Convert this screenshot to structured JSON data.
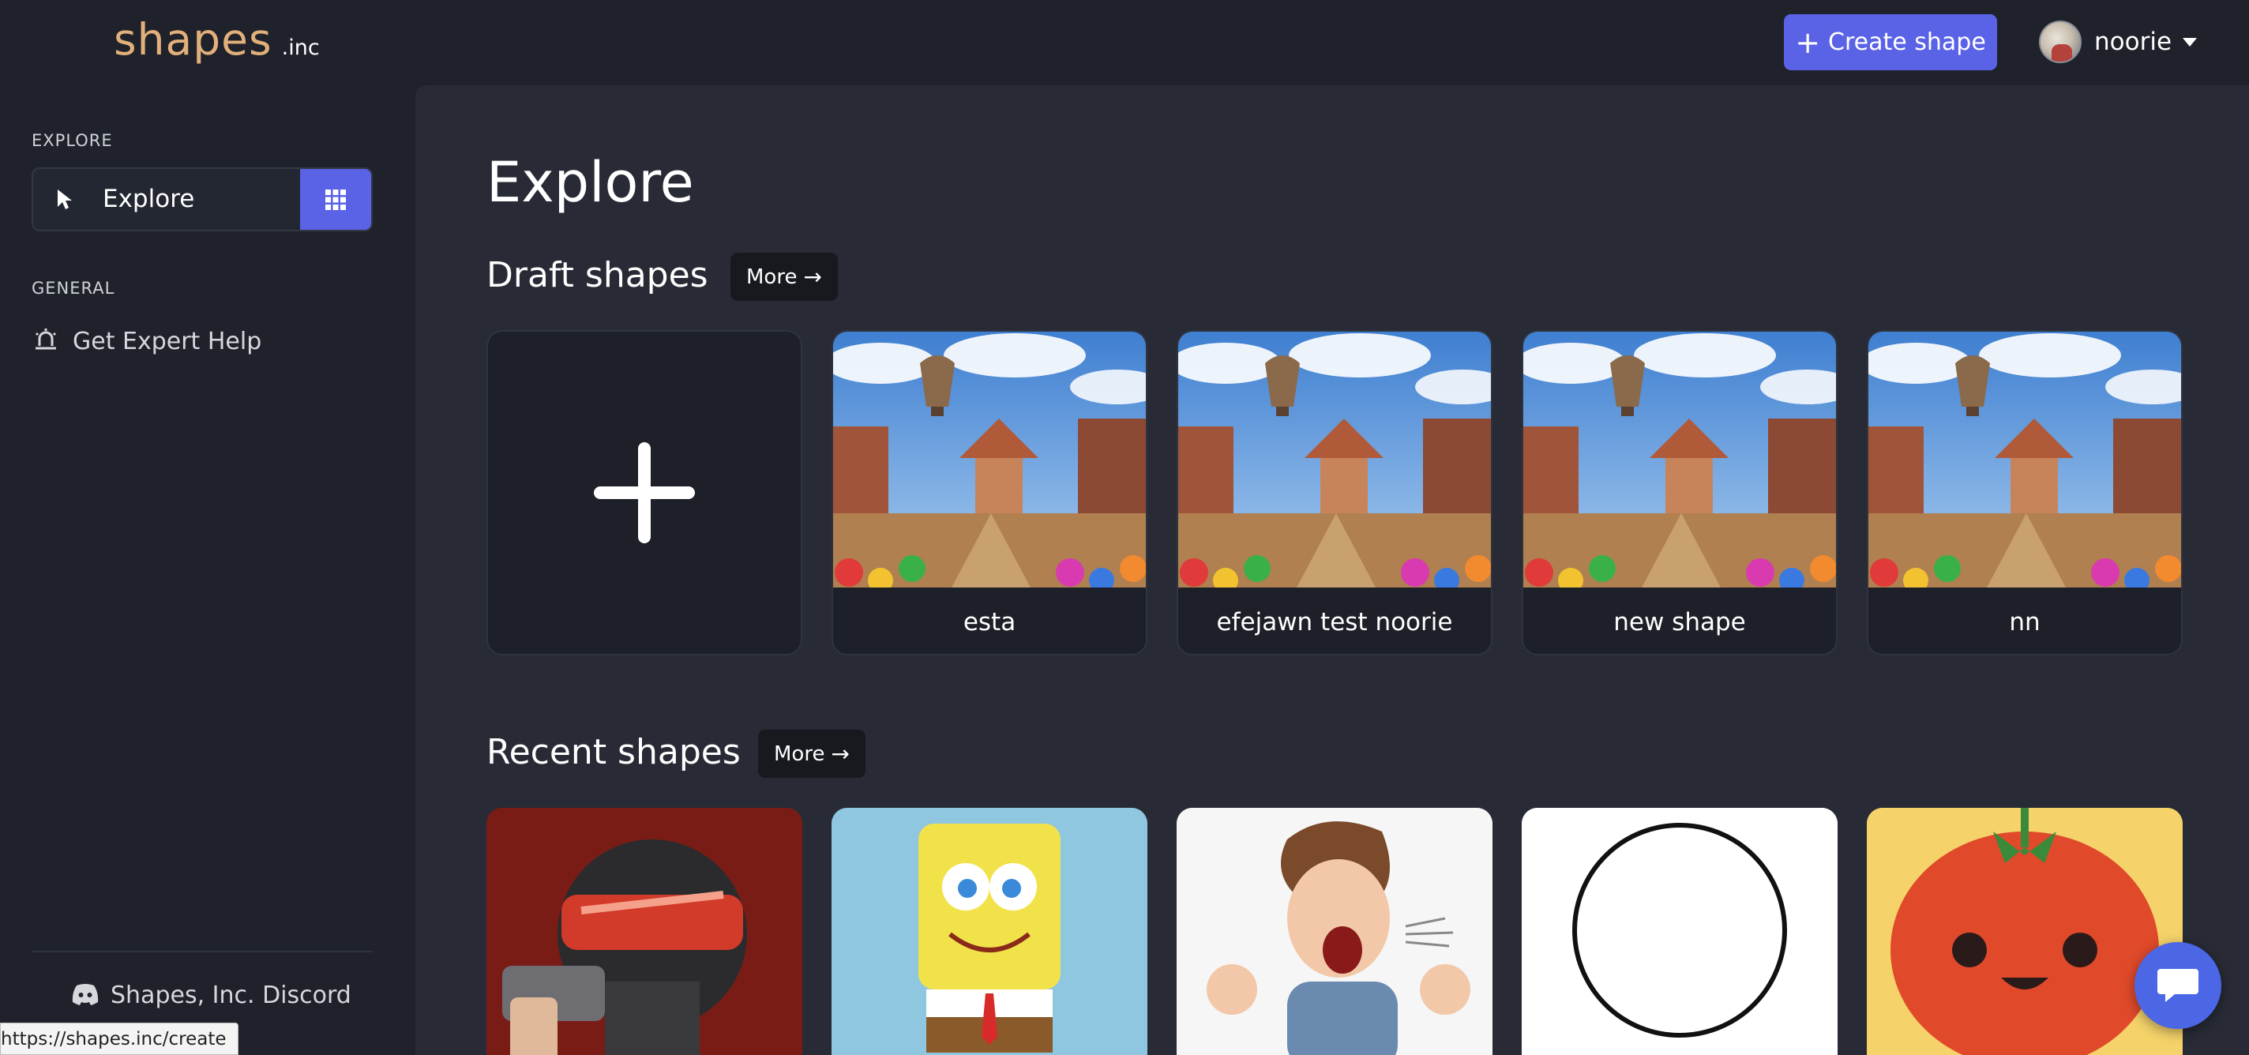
{
  "brand": {
    "name": "shapes",
    "suffix": ".inc",
    "color": "#e2b07a"
  },
  "header": {
    "create_label": "Create shape",
    "user": {
      "name": "noorie"
    }
  },
  "sidebar": {
    "section_explore": "EXPLORE",
    "explore_label": "Explore",
    "section_general": "GENERAL",
    "expert_label": "Get Expert Help",
    "discord_label": "Shapes, Inc. Discord"
  },
  "main": {
    "title": "Explore",
    "draft": {
      "title": "Draft shapes",
      "more_label": "More",
      "items": [
        {
          "name": "esta"
        },
        {
          "name": "efejawn test noorie"
        },
        {
          "name": "new shape"
        },
        {
          "name": "nn"
        }
      ]
    },
    "recent": {
      "title": "Recent shapes",
      "more_label": "More"
    }
  },
  "status_bar": {
    "url": "https://shapes.inc/create"
  },
  "colors": {
    "accent": "#5a62e6",
    "bg": "#1f222b",
    "panel": "#282b35",
    "chat": "#4b67e6"
  }
}
